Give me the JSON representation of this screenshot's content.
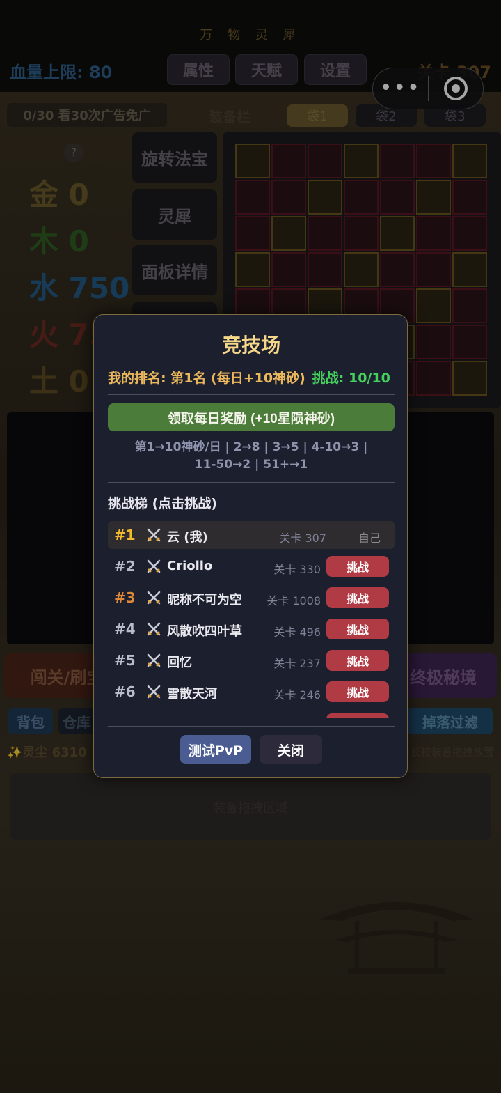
{
  "header": {
    "app_title": "万 物 灵 犀",
    "hp_limit": "血量上限: 80",
    "tabs": [
      "属性",
      "天赋",
      "设置"
    ],
    "level": "关卡 307"
  },
  "capsule": {
    "more": "•••"
  },
  "equip_bar": {
    "ad_text": "0/30 看30次广告免广",
    "label": "装备栏",
    "bags": [
      "袋1",
      "袋2",
      "袋3"
    ]
  },
  "elements": [
    {
      "char": "金",
      "value": "0",
      "color": "#6b5a2a"
    },
    {
      "char": "木",
      "value": "0",
      "color": "#2f5e22"
    },
    {
      "char": "水",
      "value": "750",
      "color": "#245b86"
    },
    {
      "char": "火",
      "value": "75",
      "color": "#6e2a22"
    },
    {
      "char": "土",
      "value": "0",
      "color": "#5c4b22"
    }
  ],
  "help": "?",
  "side_buttons": [
    "旋转法宝",
    "灵犀",
    "面板详情"
  ],
  "bottom_buttons": {
    "left": "闯关/刷宝",
    "right": "终极秘境"
  },
  "small_tabs": {
    "bag": "背包",
    "warehouse": "仓库",
    "filter": "掉落过滤"
  },
  "spirit_dust": "✨灵尘 6310",
  "drag_hint": "长按装备拖拽放置",
  "scroll_box_text": "装备拖拽区域",
  "arena": {
    "title": "竞技场",
    "my_rank": "我的排名: 第1名 (每日+10神砂)",
    "challenges": "挑战: 10/10",
    "claim_button": "领取每日奖励 (+10星陨神砂)",
    "reward_info_line1": "第1→10神砂/日 | 2→8 | 3→5 | 4-10→3 |",
    "reward_info_line2": "11-50→2 | 51+→1",
    "ladder_title": "挑战梯 (点击挑战)",
    "challenge_label": "挑战",
    "self_label": "自己",
    "ladder": [
      {
        "rank": "#1",
        "name": "云 (我)",
        "level": "关卡 307",
        "self": true,
        "rank_color": "#f2b92e"
      },
      {
        "rank": "#2",
        "name": "Criollo",
        "level": "关卡 330",
        "self": false,
        "rank_color": "#b9bccb"
      },
      {
        "rank": "#3",
        "name": "昵称不可为空",
        "level": "关卡 1008",
        "self": false,
        "rank_color": "#e0883a"
      },
      {
        "rank": "#4",
        "name": "风散吹四叶草",
        "level": "关卡 496",
        "self": false,
        "rank_color": "#b9bccb"
      },
      {
        "rank": "#5",
        "name": "回忆",
        "level": "关卡 237",
        "self": false,
        "rank_color": "#b9bccb"
      },
      {
        "rank": "#6",
        "name": "雪散天河",
        "level": "关卡 246",
        "self": false,
        "rank_color": "#b9bccb"
      }
    ],
    "test_pvp_button": "测试PvP",
    "close_button": "关闭"
  }
}
